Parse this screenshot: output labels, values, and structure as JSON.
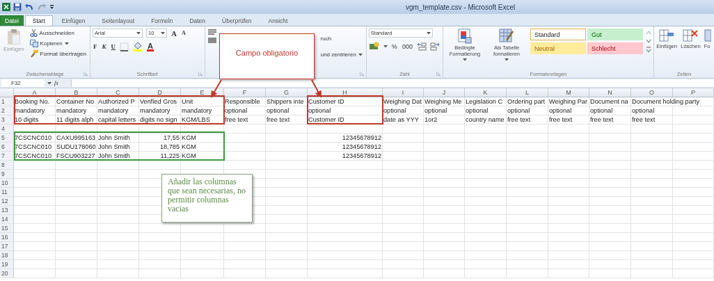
{
  "window": {
    "title": "vgm_template.csv - Microsoft Excel"
  },
  "ribbon_tabs": [
    {
      "label": "Datei",
      "kind": "file",
      "selected": false
    },
    {
      "label": "Start",
      "kind": "tab",
      "selected": true
    },
    {
      "label": "Einfügen",
      "kind": "tab",
      "selected": false
    },
    {
      "label": "Seitenlayout",
      "kind": "tab",
      "selected": false
    },
    {
      "label": "Formeln",
      "kind": "tab",
      "selected": false
    },
    {
      "label": "Daten",
      "kind": "tab",
      "selected": false
    },
    {
      "label": "Überprüfen",
      "kind": "tab",
      "selected": false
    },
    {
      "label": "Ansicht",
      "kind": "tab",
      "selected": false
    }
  ],
  "clipboard": {
    "label": "Zwischenablage",
    "paste": "Einfügen",
    "cut": "Ausschneiden",
    "copy": "Kopieren",
    "format_painter": "Format übertragen"
  },
  "font": {
    "label": "Schriftart",
    "name": "Arial",
    "size": "10",
    "grow": "A",
    "shrink": "A",
    "bold": "F",
    "italic": "K",
    "underline": "U",
    "font_color": "A"
  },
  "alignment": {
    "wrap_text": "ruch",
    "merge": "und zentrieren"
  },
  "number": {
    "label": "Zahl",
    "format": "Standard",
    "percent": "%",
    "thousands": "000"
  },
  "styles": {
    "label": "Formatvorlagen",
    "conditional": "Bedingte Formatierung",
    "as_table": "Als Tabelle formatieren",
    "cell_styles": [
      {
        "label": "Standard",
        "kind": "normal",
        "selected": true
      },
      {
        "label": "Gut",
        "kind": "good",
        "selected": false
      },
      {
        "label": "Neutral",
        "kind": "neutral",
        "selected": false
      },
      {
        "label": "Schlecht",
        "kind": "bad",
        "selected": false
      }
    ]
  },
  "cells": {
    "label": "Zellen",
    "insert": "Einfügen",
    "delete": "Löschen",
    "format": "Fo"
  },
  "formula_bar": {
    "name_box": "F32",
    "function_label": "fx"
  },
  "sheet": {
    "columns": [
      "A",
      "B",
      "C",
      "D",
      "E",
      "F",
      "G",
      "H",
      "I",
      "J",
      "K",
      "L",
      "M",
      "N",
      "O",
      "P"
    ],
    "rows": [
      {
        "number": "1",
        "cells": [
          {
            "text": "Booking No.",
            "kind": "text"
          },
          {
            "text": "Container No",
            "kind": "text"
          },
          {
            "text": "Authorized P",
            "kind": "text"
          },
          {
            "text": "Verified Gros",
            "kind": "text"
          },
          {
            "text": "Unit",
            "kind": "text"
          },
          {
            "text": "Responsible",
            "kind": "text"
          },
          {
            "text": "Shippers inte",
            "kind": "text"
          },
          {
            "text": "Customer ID",
            "kind": "text"
          },
          {
            "text": "Weighing Dat",
            "kind": "text"
          },
          {
            "text": "Weighing Me",
            "kind": "text"
          },
          {
            "text": "Legislation C",
            "kind": "text"
          },
          {
            "text": "Ordering part",
            "kind": "text"
          },
          {
            "text": "Weighing Par",
            "kind": "text"
          },
          {
            "text": "Document na",
            "kind": "text"
          },
          {
            "text": "Document holding party",
            "kind": "text"
          },
          null
        ]
      },
      {
        "number": "2",
        "cells": [
          {
            "text": "mandatory",
            "kind": "text"
          },
          {
            "text": "mandatory",
            "kind": "text"
          },
          {
            "text": "mandatory",
            "kind": "text"
          },
          {
            "text": "mandatory",
            "kind": "text"
          },
          {
            "text": "mandatory",
            "kind": "text"
          },
          {
            "text": "optional",
            "kind": "text"
          },
          {
            "text": "optional",
            "kind": "text"
          },
          {
            "text": "optional",
            "kind": "text"
          },
          {
            "text": "optional",
            "kind": "text"
          },
          {
            "text": "optional",
            "kind": "text"
          },
          {
            "text": "optional",
            "kind": "text"
          },
          {
            "text": "optional",
            "kind": "text"
          },
          {
            "text": "optional",
            "kind": "text"
          },
          {
            "text": "optional",
            "kind": "text"
          },
          {
            "text": "optional",
            "kind": "text"
          },
          null
        ]
      },
      {
        "number": "3",
        "cells": [
          {
            "text": "10 digits",
            "kind": "text"
          },
          {
            "text": "11 digits alph",
            "kind": "text"
          },
          {
            "text": "capital letters",
            "kind": "text"
          },
          {
            "text": "digits no sign",
            "kind": "text"
          },
          {
            "text": "KGM/LBS",
            "kind": "text"
          },
          {
            "text": "free text",
            "kind": "text"
          },
          {
            "text": "free text",
            "kind": "text"
          },
          {
            "text": "Customer ID",
            "kind": "text"
          },
          {
            "text": "date as YYY",
            "kind": "text"
          },
          {
            "text": "1or2",
            "kind": "text"
          },
          {
            "text": "country name",
            "kind": "text"
          },
          {
            "text": "free text",
            "kind": "text"
          },
          {
            "text": "free text",
            "kind": "text"
          },
          {
            "text": "free text",
            "kind": "text"
          },
          {
            "text": "free text",
            "kind": "text"
          },
          null
        ]
      },
      {
        "number": "4"
      },
      {
        "number": "5",
        "cells": [
          {
            "text": "7CSCNC010",
            "kind": "text"
          },
          {
            "text": "CAXU995163",
            "kind": "text"
          },
          {
            "text": "John Smith",
            "kind": "text"
          },
          {
            "text": "17,55",
            "kind": "number"
          },
          {
            "text": "KGM",
            "kind": "text"
          },
          null,
          null,
          {
            "text": "12345678912",
            "kind": "number"
          }
        ]
      },
      {
        "number": "6",
        "cells": [
          {
            "text": "7CSCNC010",
            "kind": "text"
          },
          {
            "text": "SUDU178060",
            "kind": "text"
          },
          {
            "text": "John Smith",
            "kind": "text"
          },
          {
            "text": "18,785",
            "kind": "number"
          },
          {
            "text": "KGM",
            "kind": "text"
          },
          null,
          null,
          {
            "text": "12345678912",
            "kind": "number"
          }
        ]
      },
      {
        "number": "7",
        "cells": [
          {
            "text": "7CSCNC010",
            "kind": "text"
          },
          {
            "text": "FSCU903227",
            "kind": "text"
          },
          {
            "text": "John Smith",
            "kind": "text"
          },
          {
            "text": "11,225",
            "kind": "number"
          },
          {
            "text": "KGM",
            "kind": "text"
          },
          null,
          null,
          {
            "text": "12345678912",
            "kind": "number"
          }
        ]
      },
      {
        "number": "8"
      },
      {
        "number": "9"
      },
      {
        "number": "10"
      },
      {
        "number": "11"
      },
      {
        "number": "12"
      },
      {
        "number": "13"
      },
      {
        "number": "14"
      },
      {
        "number": "15"
      },
      {
        "number": "16"
      },
      {
        "number": "17"
      },
      {
        "number": "18"
      },
      {
        "number": "19"
      },
      {
        "number": "20"
      }
    ]
  },
  "annotations": {
    "callout": "Campo obligatorio",
    "note": "Añadir las columnas que sean necesarias, no permitir columnas vacias"
  }
}
